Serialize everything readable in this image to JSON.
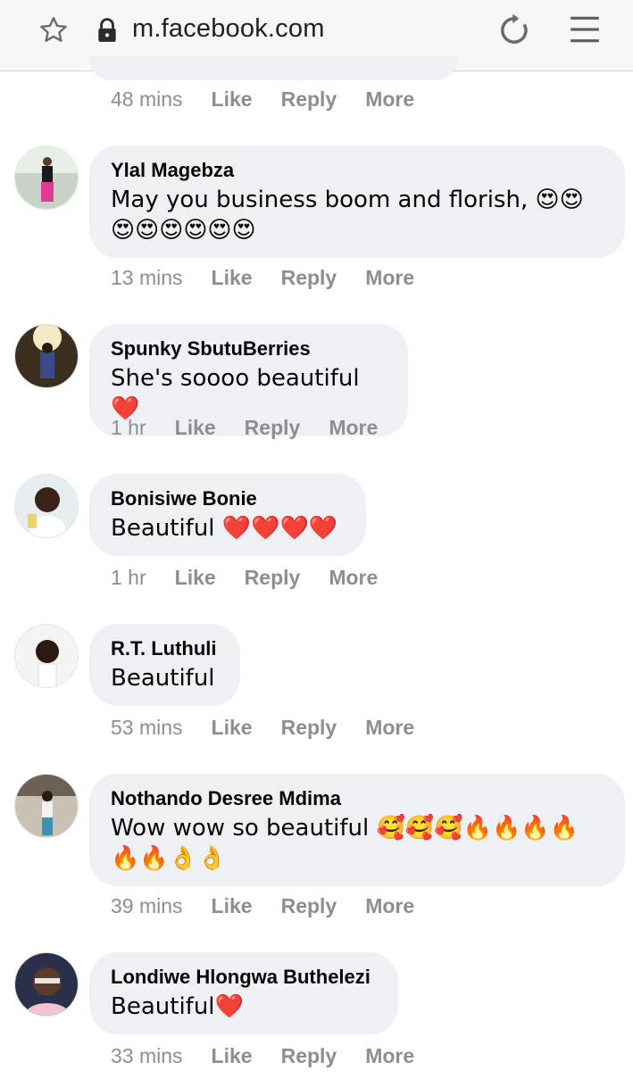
{
  "browser": {
    "url": "m.facebook.com",
    "icons": [
      "star-icon",
      "lock-icon",
      "reload-icon",
      "menu-icon"
    ]
  },
  "actions_labels": {
    "like": "Like",
    "reply": "Reply",
    "more": "More"
  },
  "top_partial": {
    "time": "48 mins"
  },
  "comments": [
    {
      "name": "Ylal Magebza",
      "text": "May you business boom and florish, 😍😍😍😍😍😍😍😍",
      "time": "13 mins"
    },
    {
      "name": "Spunky SbutuBerries",
      "text": "She's soooo beautiful ❤️",
      "time": "1 hr"
    },
    {
      "name": "Bonisiwe Bonie",
      "text": "Beautiful ❤️❤️❤️❤️",
      "time": "1 hr"
    },
    {
      "name": "R.T. Luthuli",
      "text": "Beautiful",
      "time": "53 mins"
    },
    {
      "name": "Nothando Desree Mdima",
      "text": "Wow wow so beautiful 🥰🥰🥰🔥🔥🔥🔥🔥🔥👌👌",
      "time": "39 mins"
    },
    {
      "name": "Londiwe Hlongwa Buthelezi",
      "text": "Beautiful❤️",
      "time": "33 mins"
    }
  ]
}
